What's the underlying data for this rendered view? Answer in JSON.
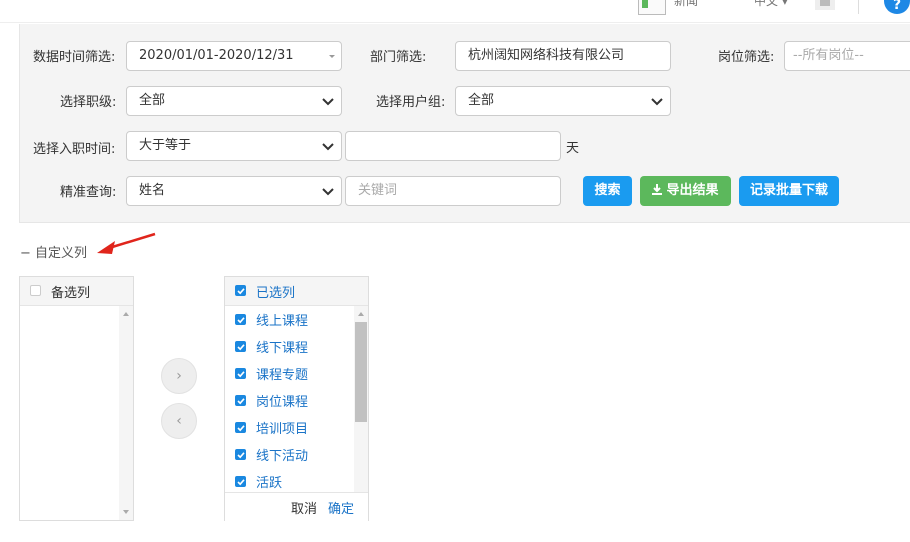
{
  "topbar": {
    "item_a": "新闻",
    "item_b": "中文 ▾",
    "help_icon": "?"
  },
  "filter": {
    "date_label": "数据时间筛选:",
    "date_value": "2020/01/01-2020/12/31",
    "dept_label": "部门筛选:",
    "dept_value": "杭州阔知网络科技有限公司",
    "post_label": "岗位筛选:",
    "post_placeholder": "--所有岗位--",
    "rank_label": "选择职级:",
    "rank_value": "全部",
    "group_label": "选择用户组:",
    "group_value": "全部",
    "hire_label": "选择入职时间:",
    "hire_op": "大于等于",
    "hire_days": "",
    "hire_unit": "天",
    "exact_label": "精准查询:",
    "exact_field": "姓名",
    "keyword_placeholder": "关键词",
    "search_btn": "搜索",
    "export_btn": "导出结果",
    "batch_btn": "记录批量下载"
  },
  "custom_columns": {
    "toggle": "− 自定义列",
    "available_title": "备选列",
    "selected_title": "已选列",
    "selected_items": [
      "线上课程",
      "线下课程",
      "课程专题",
      "岗位课程",
      "培训项目",
      "线下活动",
      "活跃"
    ],
    "move_right": "›",
    "move_left": "‹",
    "cancel": "取消",
    "confirm": "确定"
  },
  "colors": {
    "accent_blue": "#1a9bf0",
    "export_green": "#5cb85c",
    "link_blue": "#1a73c7",
    "arrow_red": "#e0251c"
  }
}
